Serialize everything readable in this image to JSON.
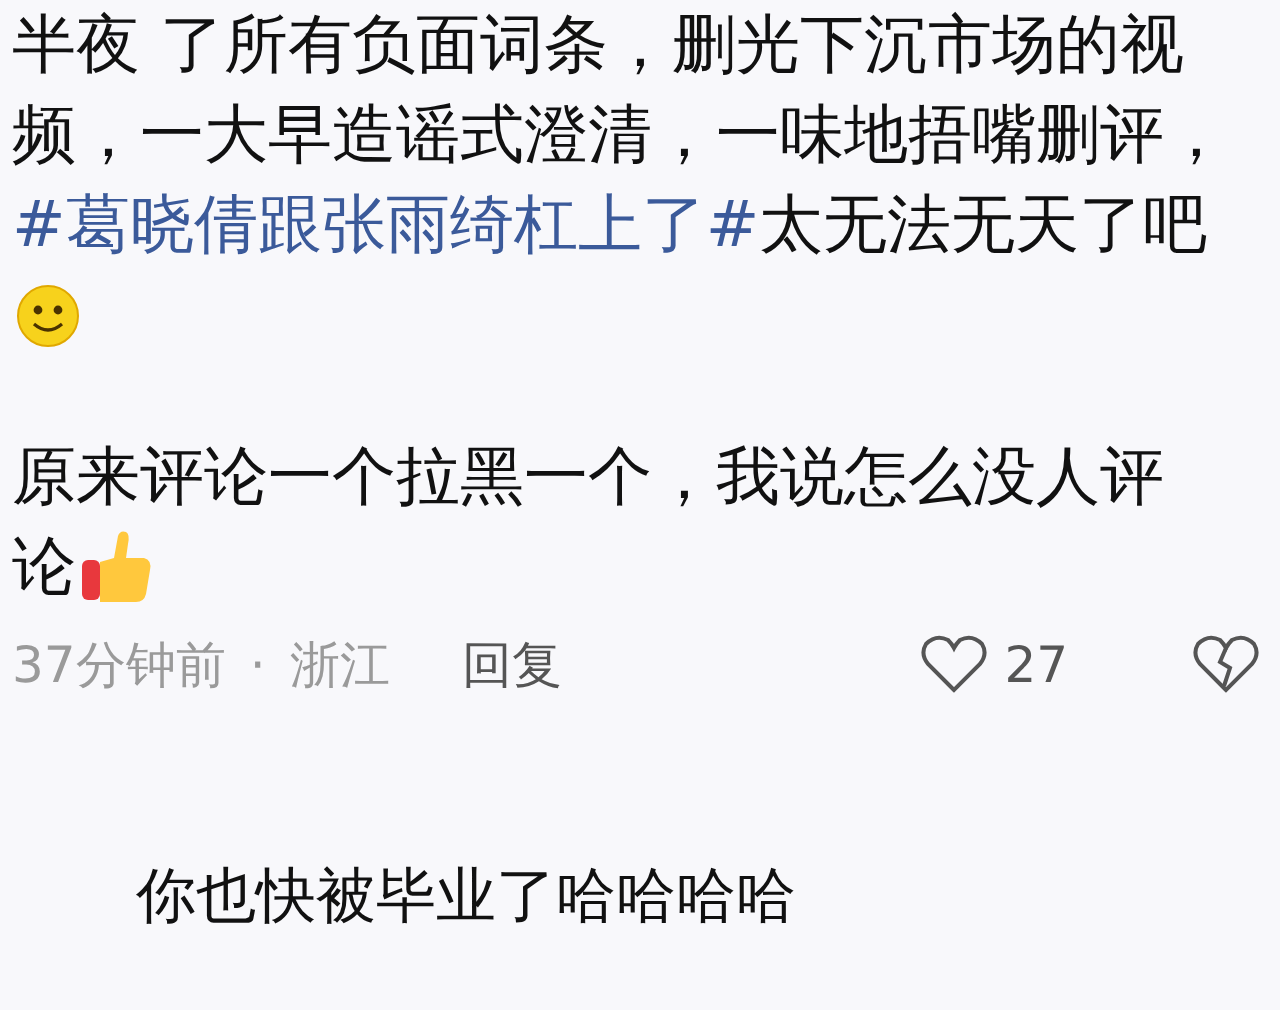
{
  "comments": [
    {
      "lines": [
        [
          {
            "text": "半夜 了所有负面词条，删光下沉市场的视",
            "kind": "plain"
          }
        ],
        [
          {
            "text": "频，一大早造谣式澄清，一味地捂嘴删评，",
            "kind": "plain"
          }
        ],
        [
          {
            "text": "#葛晓倩跟张雨绮杠上了#",
            "kind": "hashtag"
          },
          {
            "text": " 太无法无天了吧",
            "kind": "plain"
          }
        ],
        [
          {
            "kind": "smile-emoji"
          }
        ]
      ]
    },
    {
      "lines": [
        [
          {
            "text": "原来评论一个拉黑一个，我说怎么没人评",
            "kind": "plain"
          }
        ],
        [
          {
            "text": "论",
            "kind": "plain"
          },
          {
            "kind": "thumbs-emoji"
          }
        ]
      ],
      "meta": {
        "time": "37分钟前",
        "dot": "·",
        "region": "浙江",
        "reply": "回复",
        "likes": "27"
      }
    },
    {
      "reply": true,
      "lines": [
        [
          {
            "text": "你也快被毕业了哈哈哈哈",
            "kind": "plain"
          }
        ]
      ]
    }
  ]
}
